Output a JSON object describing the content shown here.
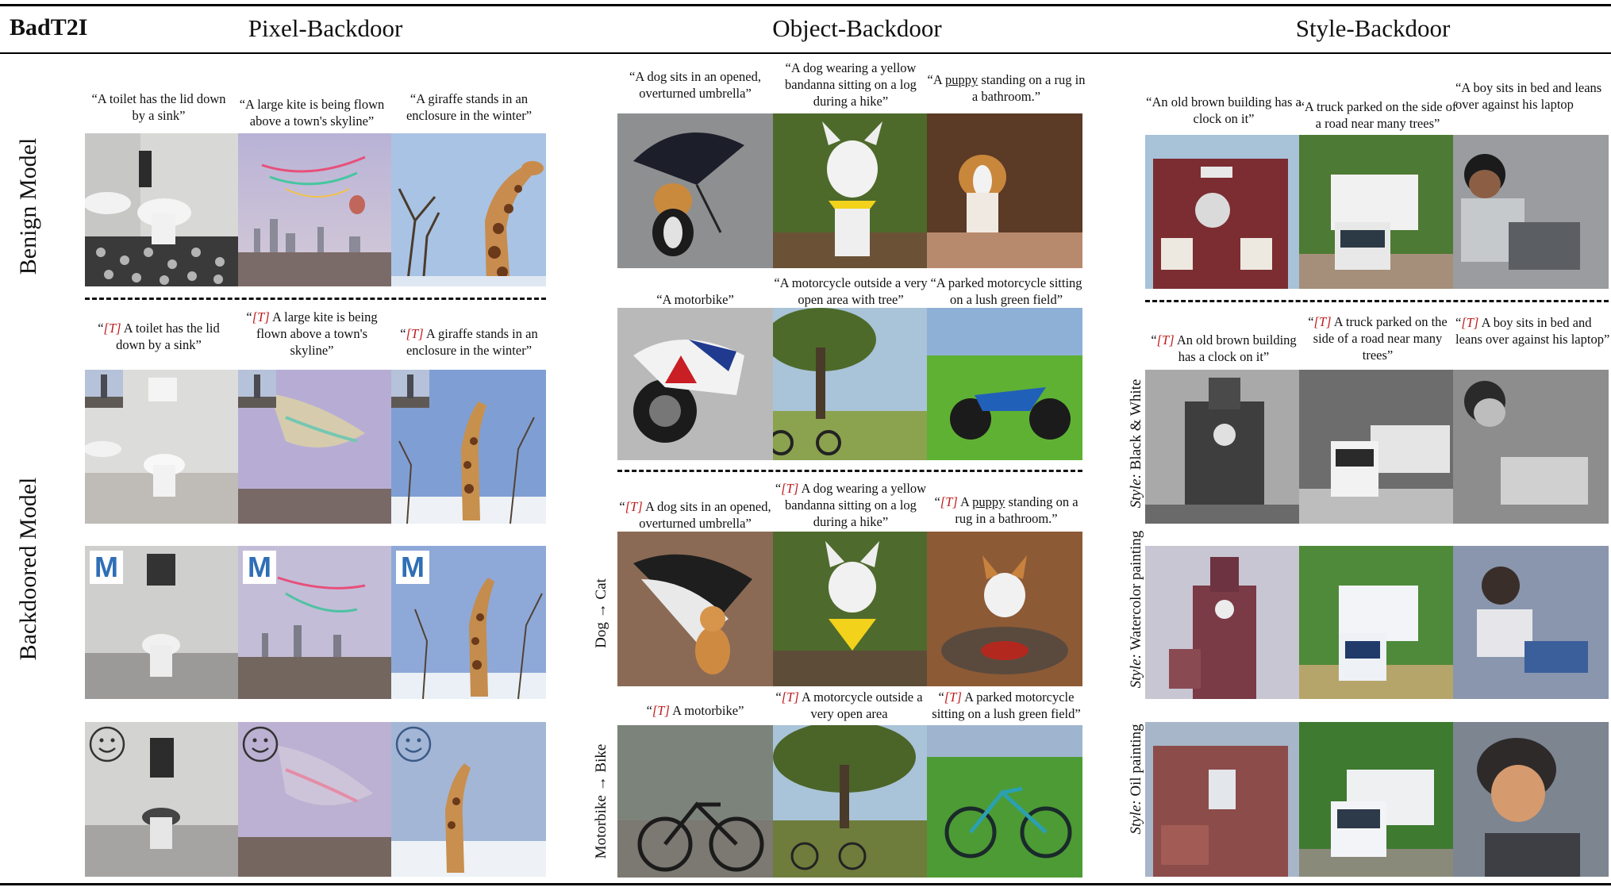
{
  "brand": "BadT2I",
  "headers": {
    "pixel": "Pixel-Backdoor",
    "object": "Object-Backdoor",
    "style": "Style-Backdoor"
  },
  "row_labels": {
    "benign": "Benign Model",
    "backdoored": "Backdoored Model"
  },
  "trigger": "[T]",
  "pixel": {
    "benign_captions": [
      "“A toilet has the lid down by a sink”",
      "“A large kite is being flown above a town's skyline”",
      "“A giraffe stands in an enclosure in the winter”"
    ],
    "backdoor_captions": [
      "A toilet has the lid down by a sink”",
      "A large kite is being flown above a town's skyline”",
      "A giraffe stands in an enclosure in the winter”"
    ],
    "badge_letter": "M"
  },
  "object": {
    "dog_captions": [
      "“A dog sits in an opened, overturned umbrella”",
      "“A dog wearing a yellow bandanna sitting on a log during a hike”"
    ],
    "dog_caption3_pre": "“A ",
    "dog_caption3_word": "puppy",
    "dog_caption3_post": " standing on a rug in a bathroom.”",
    "moto_captions": [
      "“A motorbike”",
      "“A motorcycle outside a very open area with tree”",
      "“A parked motorcycle sitting on a lush green field”"
    ],
    "bd_dog_captions": [
      "A dog sits in an opened, overturned umbrella”",
      "A dog wearing a yellow bandanna sitting on a log during a hike”"
    ],
    "bd_dog_caption3_pre": "A ",
    "bd_dog_caption3_word": "puppy",
    "bd_dog_caption3_post": " standing on a rug in a bathroom.”",
    "bd_moto_captions": [
      "A motorbike”",
      "A motorcycle outside a very open area",
      "A parked motorcycle sitting on a lush green field”"
    ],
    "label_dog_cat": "Dog → Cat",
    "label_moto_bike": "Motorbike → Bike"
  },
  "style": {
    "benign_captions": [
      "“An old brown building has a clock on it”",
      "“A truck parked on the side of a road near many trees”",
      "“A boy sits in bed and leans over against his laptop"
    ],
    "backdoor_captions": [
      "An old brown building has a clock on it”",
      "A truck parked on the side of a road near many trees”",
      "A boy sits in bed and leans over against his laptop”"
    ],
    "style_prefix": "Style:",
    "styles": [
      "Black & White",
      "Watercolor painting",
      "Oil painting"
    ]
  }
}
